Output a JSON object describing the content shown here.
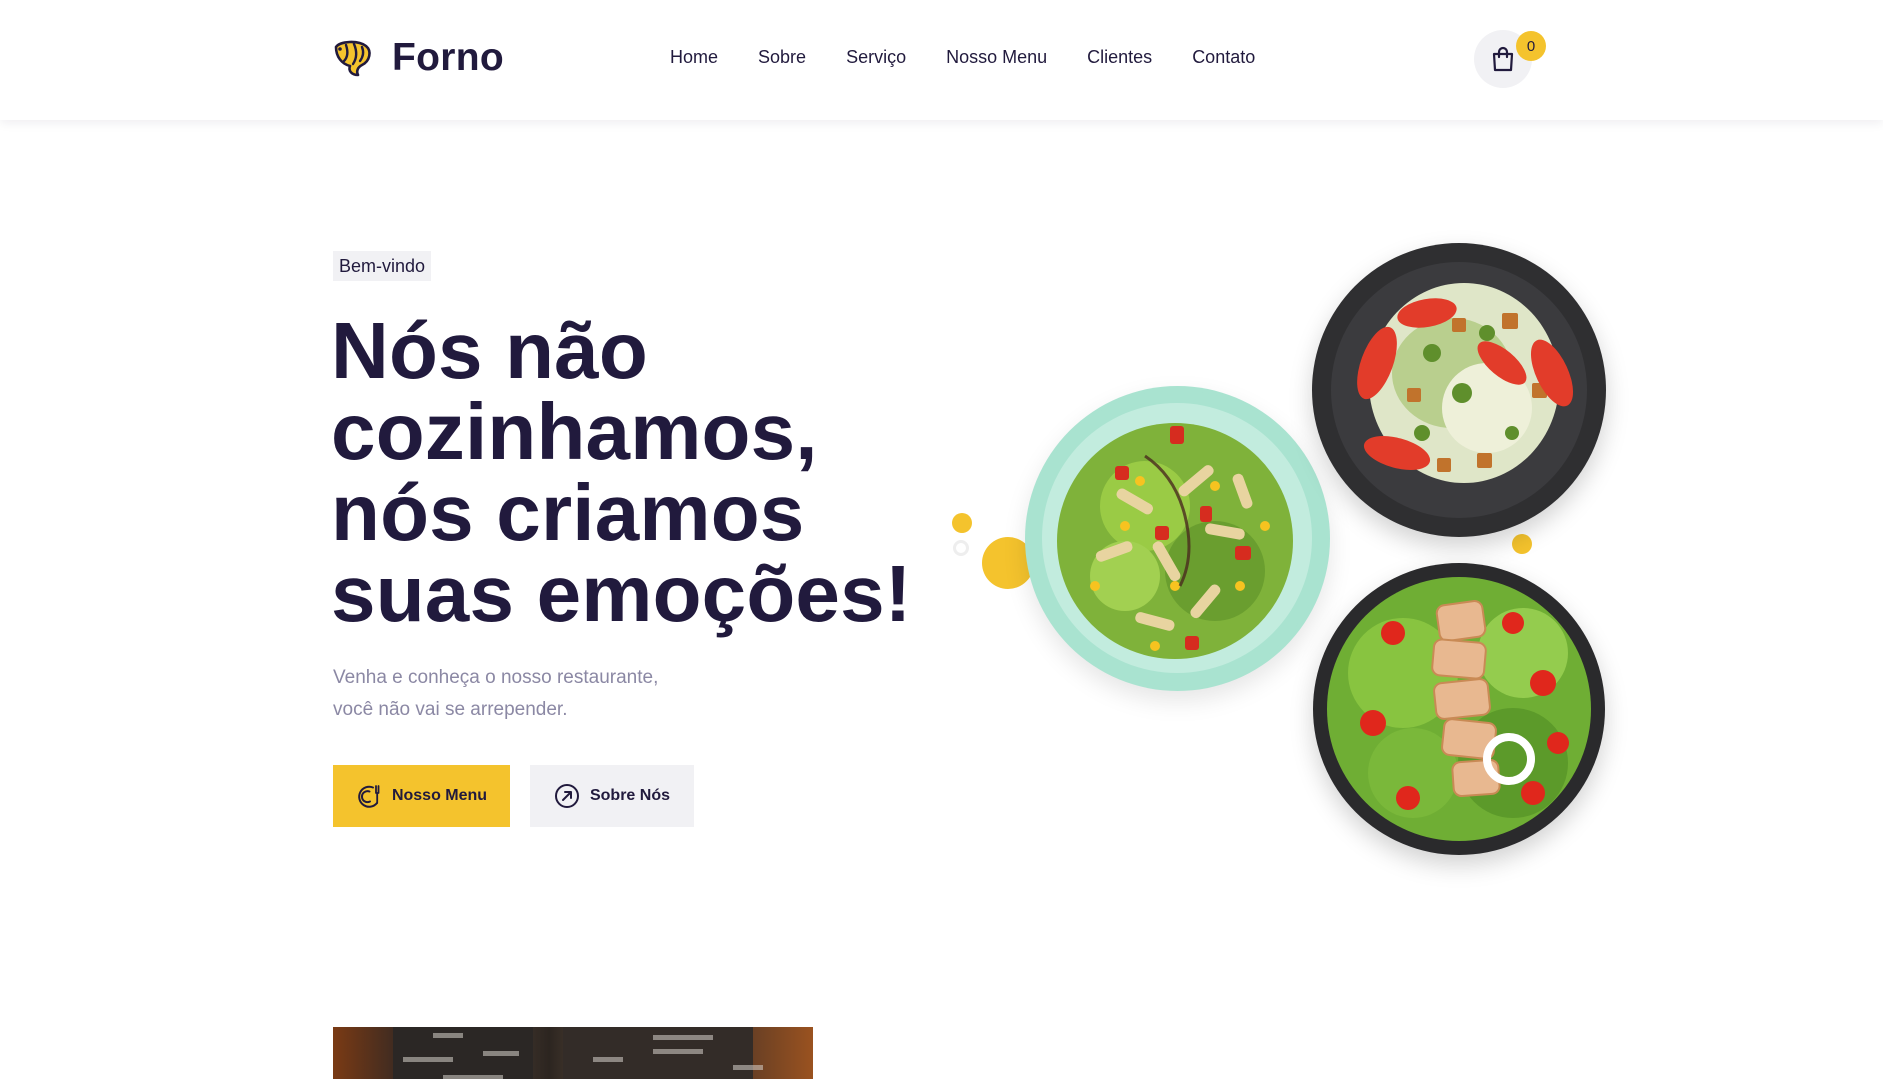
{
  "header": {
    "brand": "Forno",
    "nav": [
      "Home",
      "Sobre",
      "Serviço",
      "Nosso Menu",
      "Clientes",
      "Contato"
    ],
    "cart_count": "0"
  },
  "hero": {
    "tag": "Bem-vindo",
    "headline_lines": [
      "Nós não",
      "cozinhamos,",
      "nós criamos",
      "suas emoções!"
    ],
    "subtitle_lines": [
      "Venha e conheça o nosso restaurante,",
      "você não vai se arrepender."
    ],
    "primary_button": "Nosso Menu",
    "secondary_button": "Sobre Nós"
  },
  "colors": {
    "accent": "#f4c32d",
    "dark": "#211a3d",
    "muted": "#8b88a4",
    "light_bg": "#f1f1f4"
  },
  "icons": {
    "logo": "shrimp-icon",
    "cart": "shopping-bag-icon",
    "primary_button": "dish-icon",
    "secondary_button": "compass-arrow-icon"
  }
}
